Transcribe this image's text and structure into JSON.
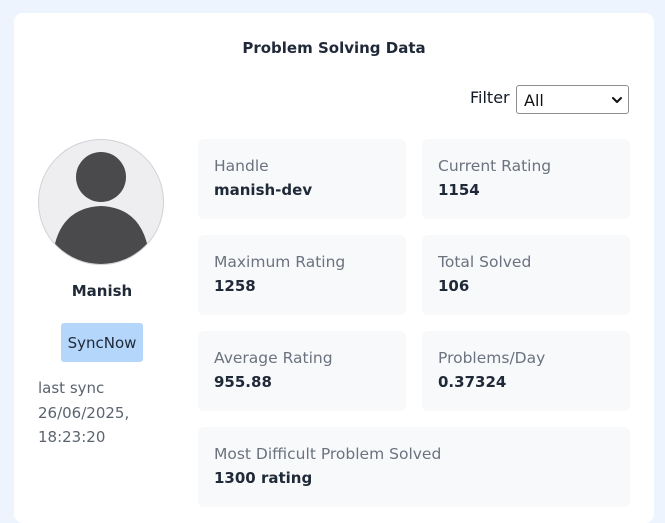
{
  "title": "Problem Solving Data",
  "filter": {
    "label": "Filter",
    "selected": "All"
  },
  "profile": {
    "name": "Manish",
    "sync_button": "SyncNow",
    "last_sync": "last sync 26/06/2025, 18:23:20"
  },
  "stats": [
    {
      "label": "Handle",
      "value": "manish-dev"
    },
    {
      "label": "Current Rating",
      "value": "1154"
    },
    {
      "label": "Maximum Rating",
      "value": "1258"
    },
    {
      "label": "Total Solved",
      "value": "106"
    },
    {
      "label": "Average Rating",
      "value": "955.88"
    },
    {
      "label": "Problems/Day",
      "value": "0.37324"
    },
    {
      "label": "Most Difficult Problem Solved",
      "value": "1300 rating"
    }
  ],
  "colors": {
    "page_bg": "#eef4fd",
    "card_bg": "#ffffff",
    "stat_bg": "#f8f9fa",
    "sync_button_bg": "#b4d6fb",
    "avatar_fill": "#4a4a4d"
  }
}
